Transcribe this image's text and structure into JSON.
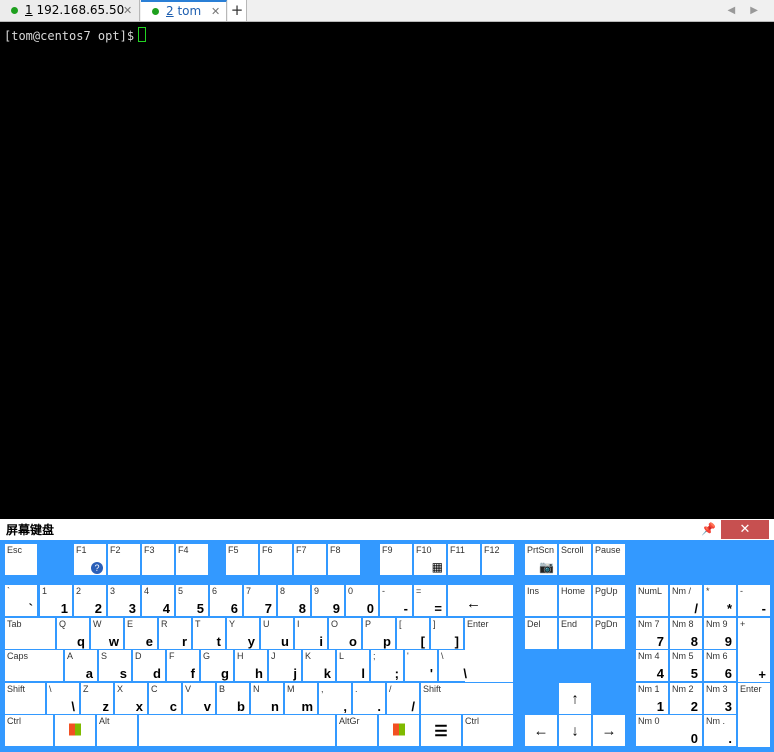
{
  "tabs": [
    {
      "num": "1",
      "label": " 192.168.65.50",
      "close": "✕"
    },
    {
      "num": "2",
      "label": " tom",
      "close": "✕"
    }
  ],
  "tab_add": "+",
  "tab_nav": "◀ ▶",
  "terminal": {
    "prompt": "[tom@centos7 opt]$"
  },
  "osk": {
    "title": "屏幕键盘",
    "pin_icon": "pin-icon",
    "close": "✕",
    "keys": {
      "esc": "Esc",
      "f1": "F1",
      "f2": "F2",
      "f3": "F3",
      "f4": "F4",
      "f5": "F5",
      "f6": "F6",
      "f7": "F7",
      "f8": "F8",
      "f9": "F9",
      "f10": "F10",
      "f11": "F11",
      "f12": "F12",
      "prtsc": "PrtScn",
      "scroll": "Scroll",
      "pause": "Pause",
      "tab": "Tab",
      "caps": "Caps",
      "shift": "Shift",
      "ctrl": "Ctrl",
      "alt": "Alt",
      "altgr": "AltGr",
      "enter": "Enter",
      "ins": "Ins",
      "home": "Home",
      "pgup": "PgUp",
      "del": "Del",
      "end": "End",
      "pgdn": "PgDn",
      "numlock": "NumL",
      "num_slash": "Nm /",
      "num_star": "*",
      "num_minus": "-",
      "num_plus": "+",
      "num_enter": "Enter",
      "nm7": "Nm 7",
      "nm8": "Nm 8",
      "nm9": "Nm 9",
      "nm4": "Nm 4",
      "nm5": "Nm 5",
      "nm6": "Nm 6",
      "nm1": "Nm 1",
      "nm2": "Nm 2",
      "nm3": "Nm 3",
      "nm0": "Nm 0",
      "nm_dot": "Nm ."
    }
  }
}
